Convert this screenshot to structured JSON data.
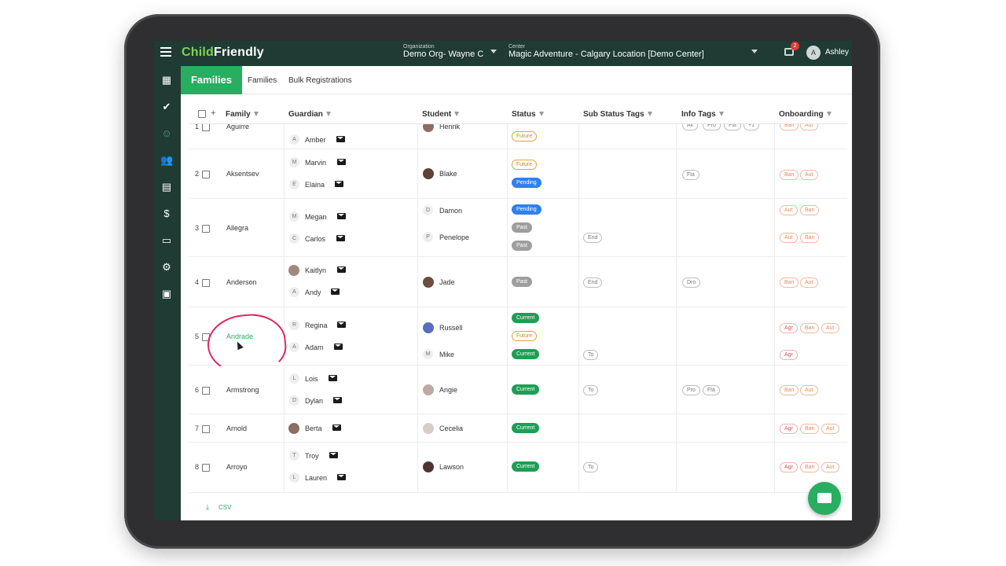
{
  "app": {
    "logo_child": "Child",
    "logo_friendly": "Friendly",
    "org_label": "Organization",
    "org_value": "Demo Org- Wayne C",
    "center_label": "Center",
    "center_value": "Magic Adventure - Calgary Location [Demo Center]",
    "notifications_count": "2",
    "user_initial": "A",
    "user_name": "Ashley"
  },
  "subheader": {
    "section": "Families",
    "tabs": [
      "Families",
      "Bulk Registrations"
    ]
  },
  "table": {
    "headers": [
      "Family",
      "Guardian",
      "Student",
      "Status",
      "Sub Status Tags",
      "Info Tags",
      "Onboarding"
    ],
    "plus": "+",
    "rows": [
      {
        "num": "1",
        "family": "Aguirre",
        "guardians": [
          "Amber"
        ],
        "guardian_initials": [
          "A"
        ],
        "students": [
          "Henrik"
        ],
        "status": [
          "Future"
        ],
        "sub": [],
        "info": [
          "All",
          "Pro",
          "Fla",
          "+1"
        ],
        "onb": [
          "Ban",
          "Aut"
        ]
      },
      {
        "num": "2",
        "family": "Aksentsev",
        "guardians": [
          "Marvin",
          "Elaina"
        ],
        "guardian_initials": [
          "M",
          "E"
        ],
        "students": [
          "Blake"
        ],
        "status": [
          "Future",
          "Pending"
        ],
        "sub": [],
        "info": [
          "Fla"
        ],
        "onb": [
          "Ban",
          "Aut"
        ]
      },
      {
        "num": "3",
        "family": "Allegra",
        "guardians": [
          "Megan",
          "Carlos"
        ],
        "guardian_initials": [
          "M",
          "C"
        ],
        "students": [
          "Damon",
          "Penelope"
        ],
        "student_initials": [
          "D",
          "P"
        ],
        "status": [
          "Pending",
          "Past",
          "Past"
        ],
        "sub": [
          "End"
        ],
        "info": [],
        "onb": [
          "Aut",
          "Ban",
          "Aut",
          "Ban"
        ]
      },
      {
        "num": "4",
        "family": "Anderson",
        "guardians": [
          "Kaitlyn",
          "Andy"
        ],
        "guardian_initials": [
          "",
          "A"
        ],
        "students": [
          "Jade"
        ],
        "status": [
          "Past"
        ],
        "sub": [
          "End"
        ],
        "info": [
          "Dro"
        ],
        "onb": [
          "Ban",
          "Aut"
        ]
      },
      {
        "num": "5",
        "family": "Andrade",
        "guardians": [
          "Regina",
          "Adam"
        ],
        "guardian_initials": [
          "R",
          "A"
        ],
        "students": [
          "Russell",
          "Mike"
        ],
        "student_initials": [
          "",
          "M"
        ],
        "status": [
          "Current",
          "Future",
          "Current"
        ],
        "sub": [
          "To"
        ],
        "info": [],
        "onb": [
          "Agr",
          "Ban",
          "Aut",
          "Agr"
        ]
      },
      {
        "num": "6",
        "family": "Armstrong",
        "guardians": [
          "Lois",
          "Dylan"
        ],
        "guardian_initials": [
          "L",
          "D"
        ],
        "students": [
          "Angie"
        ],
        "status": [
          "Current"
        ],
        "sub": [
          "To"
        ],
        "info": [
          "Pro",
          "Fla"
        ],
        "onb": [
          "Ban",
          "Aut"
        ]
      },
      {
        "num": "7",
        "family": "Arnold",
        "guardians": [
          "Berta"
        ],
        "guardian_initials": [
          ""
        ],
        "students": [
          "Cecelia"
        ],
        "status": [
          "Current"
        ],
        "sub": [],
        "info": [],
        "onb": [
          "Agr",
          "Ban",
          "Aut"
        ]
      },
      {
        "num": "8",
        "family": "Arroyo",
        "guardians": [
          "Troy",
          "Lauren"
        ],
        "guardian_initials": [
          "T",
          "L"
        ],
        "students": [
          "Lawson"
        ],
        "status": [
          "Current"
        ],
        "sub": [
          "To"
        ],
        "info": [],
        "onb": [
          "Agr",
          "Ban",
          "Aut"
        ]
      }
    ]
  },
  "footer": {
    "csv_icon": "⤓",
    "csv_label": "CSV"
  },
  "sidebar_icons": [
    "apps-icon",
    "checkin-icon",
    "child-icon",
    "families-icon",
    "messages-icon",
    "billing-icon",
    "documents-icon",
    "settings-icon",
    "staff-icon"
  ]
}
